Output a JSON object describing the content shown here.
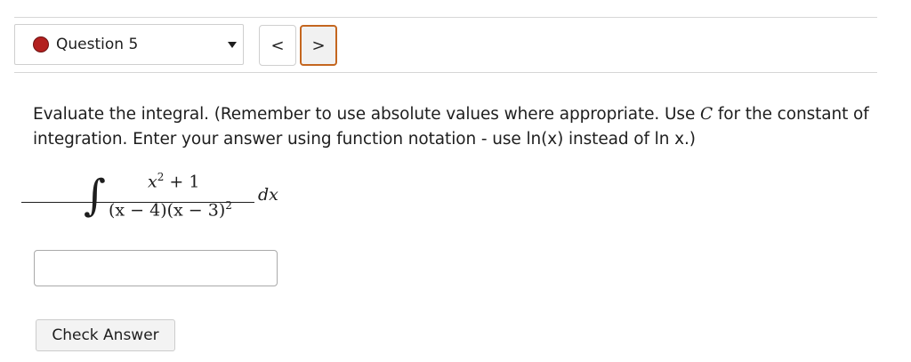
{
  "question_nav": {
    "selected": "Question 5",
    "prev_label": "<",
    "next_label": ">",
    "status_color": "#b3201f",
    "accent_color": "#c4661f"
  },
  "prompt": {
    "text_before_c": "Evaluate the integral. (Remember to use absolute values where appropriate. Use ",
    "c_symbol": "C",
    "text_after_c": " for the constant of integration. Enter your answer using function notation - use ln(x) instead of ln x.)"
  },
  "formula": {
    "integral_sign": "∫",
    "numerator_base": "x",
    "numerator_exp": "2",
    "numerator_rest": " + 1",
    "denominator_base": "(x − 4)(x − 3)",
    "denominator_exp": "2",
    "differential": "dx"
  },
  "answer": {
    "value": "",
    "placeholder": ""
  },
  "check_button": {
    "label": "Check Answer"
  }
}
